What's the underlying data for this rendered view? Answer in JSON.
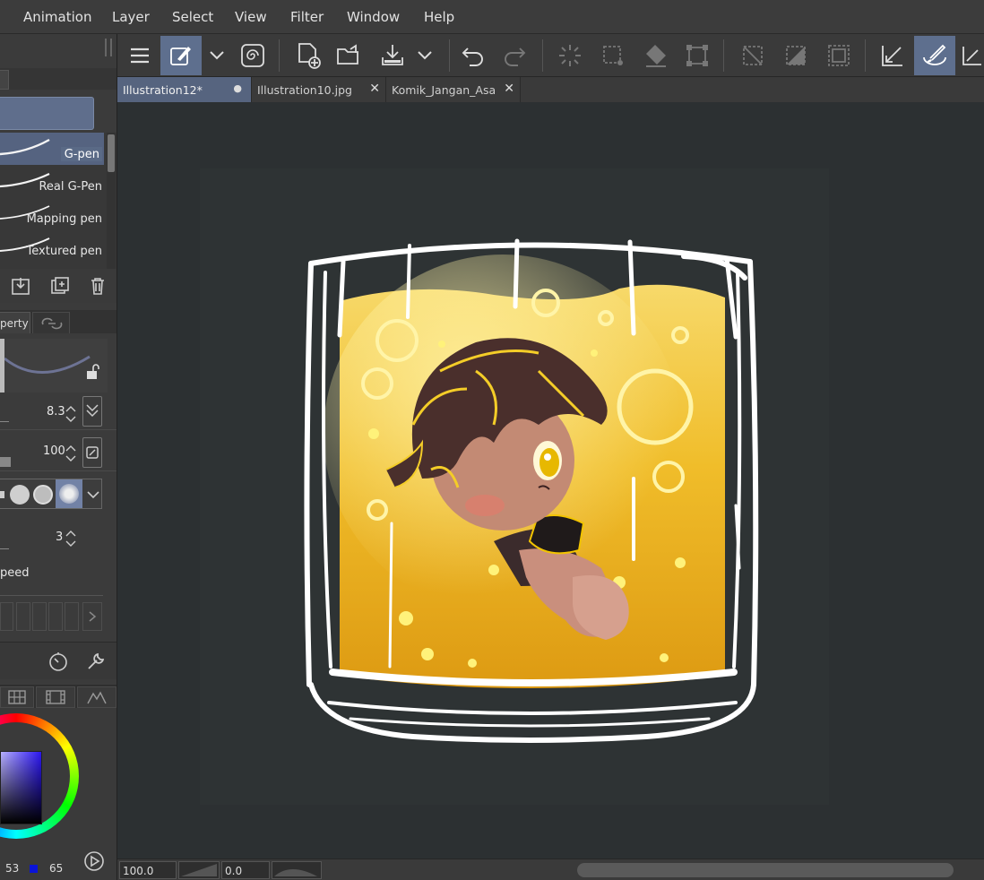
{
  "menu": {
    "items": [
      "Animation",
      "Layer",
      "Select",
      "View",
      "Filter",
      "Window",
      "Help"
    ]
  },
  "tabs": [
    {
      "label": "Illustration12*",
      "active": true,
      "close": "●"
    },
    {
      "label": "Illustration10.jpg",
      "active": false,
      "close": "✕"
    },
    {
      "label": "Komik_Jangan_Asal_",
      "active": false,
      "close": "✕"
    }
  ],
  "brushes": [
    {
      "label": "G-pen",
      "selected": true
    },
    {
      "label": "Real G-Pen",
      "selected": false
    },
    {
      "label": "Mapping pen",
      "selected": false
    },
    {
      "label": "Textured pen",
      "selected": false
    }
  ],
  "tool_property": {
    "tab_label": "perty",
    "brush_size": "8.3",
    "opacity": "100",
    "stabilization": "3",
    "speed_label": "peed"
  },
  "color": {
    "value_a": "53",
    "value_b": "65",
    "indicator_color": "#0a14d8"
  },
  "status": {
    "zoom": "100.0",
    "rotation": "0.0"
  },
  "toolbar_icons": [
    "menu-icon",
    "brush-tool-icon",
    "chevron-down-icon",
    "spiral-icon",
    "new-file-icon",
    "open-folder-icon",
    "save-icon",
    "chevron-down-icon",
    "undo-icon",
    "redo-icon",
    "loading-icon",
    "selection-icon",
    "fill-icon",
    "transform-icon",
    "deselect-icon",
    "invert-selection-icon",
    "selection-border-icon",
    "ruler-icon",
    "brush-active-icon",
    "ruler2-icon"
  ],
  "colors": {
    "accent": "#5e6f8e",
    "liquid_top": "#f7d96a",
    "liquid_bottom": "#dd9a12"
  }
}
